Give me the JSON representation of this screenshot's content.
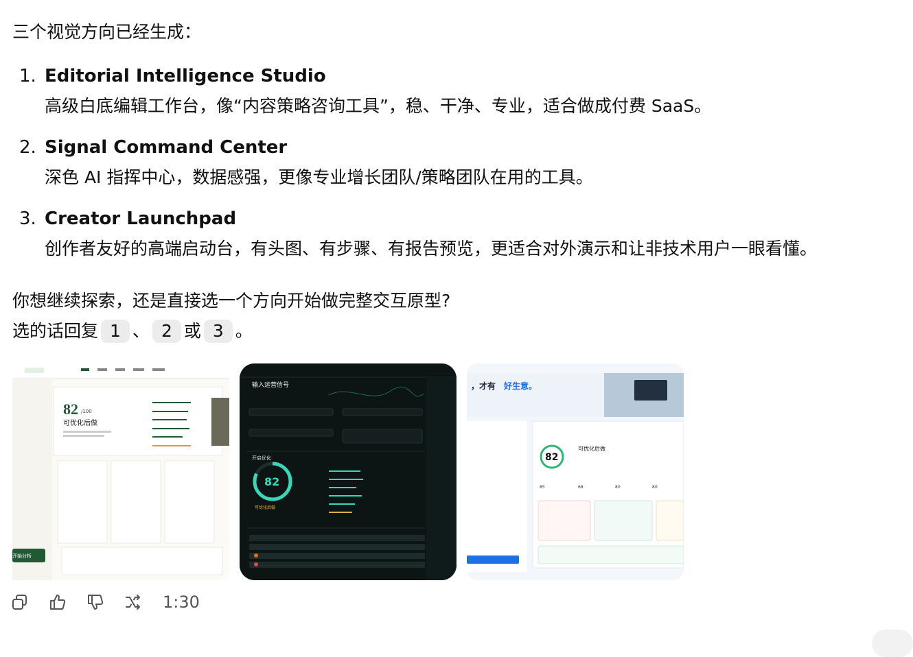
{
  "message": {
    "intro": "三个视觉方向已经生成：",
    "directions": [
      {
        "num": "1.",
        "title": "Editorial Intelligence Studio",
        "desc": "高级白底编辑工作台，像“内容策略咨询工具”，稳、干净、专业，适合做成付费 SaaS。"
      },
      {
        "num": "2.",
        "title": "Signal Command Center",
        "desc": "深色 AI 指挥中心，数据感强，更像专业增长团队/策略团队在用的工具。"
      },
      {
        "num": "3.",
        "title": "Creator Launchpad",
        "desc": "创作者友好的高端启动台，有头图、有步骤、有报告预览，更适合对外演示和让非技术用户一眼看懂。"
      }
    ],
    "question": "你想继续探索，还是直接选一个方向开始做完整交互原型?",
    "reply_prefix": "选的话回复",
    "reply_options": [
      "1",
      "2",
      "3"
    ],
    "reply_sep1": "、",
    "reply_sep2": "或",
    "reply_suffix": "。"
  },
  "thumbnails": {
    "editorial": {
      "score": "82",
      "score_unit": "/100",
      "score_label": "可优化后做",
      "cta": "开始分析"
    },
    "signal": {
      "heading": "输入运营信号",
      "score": "82",
      "section": "开启优化",
      "status": "可优化后做"
    },
    "launchpad": {
      "headline_pre": "，才有",
      "headline_accent": "好生意。",
      "score": "82",
      "score_label": "可优化后做",
      "scores": [
        "85",
        "68",
        "80",
        "80"
      ]
    }
  },
  "actions": {
    "time": "1:30"
  },
  "colors": {
    "accent_green": "#1f5a35",
    "signal_teal": "#3ad6b8",
    "launch_blue": "#1f6fe5"
  },
  "icons": [
    "copy-icon",
    "thumbs-up-icon",
    "thumbs-down-icon",
    "share-icon"
  ]
}
